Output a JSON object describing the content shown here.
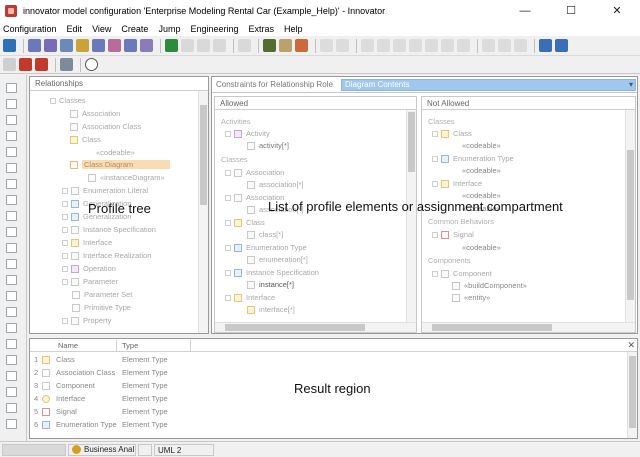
{
  "window": {
    "title": "innovator model configuration 'Enterprise Modeling Rental Car (Example_Help)' - Innovator",
    "minimize_glyph": "—",
    "maximize_glyph": "☐",
    "close_glyph": "✕"
  },
  "menu": [
    "Configuration",
    "Edit",
    "View",
    "Create",
    "Jump",
    "Engineering",
    "Extras",
    "Help"
  ],
  "left_pane": {
    "header": "Relationships",
    "root": "Classes",
    "items": [
      {
        "label": "Association",
        "icon": "association-icon"
      },
      {
        "label": "Association Class",
        "icon": "association-class-icon"
      },
      {
        "label": "Class",
        "icon": "class-icon"
      },
      {
        "label": "«codeable»",
        "icon": ""
      },
      {
        "label": "Class Diagram",
        "icon": "class-diagram-icon"
      },
      {
        "label": "«instanceDiagram»",
        "icon": "instance-diagram-icon"
      },
      {
        "label": "Enumeration Literal",
        "icon": "enumeration-literal-icon"
      },
      {
        "label": "Generalization",
        "icon": "generalization-icon"
      },
      {
        "label": "Generalization",
        "icon": "generalization-icon"
      },
      {
        "label": "Instance Specification",
        "icon": "instance-specification-icon"
      },
      {
        "label": "Interface",
        "icon": "interface-icon"
      },
      {
        "label": "Interface Realization",
        "icon": "interface-realization-icon"
      },
      {
        "label": "Operation",
        "icon": "operation-icon"
      },
      {
        "label": "Parameter",
        "icon": "parameter-icon"
      },
      {
        "label": "Parameter Set",
        "icon": "parameter-set-icon"
      },
      {
        "label": "Primitive Type",
        "icon": "primitive-type-icon"
      },
      {
        "label": "Property",
        "icon": "property-icon"
      }
    ],
    "overlay": "Profile tree"
  },
  "constraints": {
    "label": "Constraints for Relationship Role",
    "selected": "Diagram Contents",
    "overlay": "List of  profile elements or assignment compartment"
  },
  "allowed": {
    "header": "Allowed",
    "groups": [
      {
        "category": "Activities",
        "items": [
          "Activity",
          "activity[*]"
        ]
      },
      {
        "category": "Classes",
        "items": [
          "Association",
          "association[*]",
          "Association",
          "association[*]",
          "Class",
          "class[*]",
          "Enumeration Type",
          "enumeration[*]",
          "Instance Specification",
          "instance[*]",
          "Interface",
          "interface[*]"
        ]
      }
    ]
  },
  "not_allowed": {
    "header": "Not Allowed",
    "groups": [
      {
        "category": "Classes",
        "items": [
          "Class",
          "«codeable»",
          "Enumeration Type",
          "«codeable»",
          "Interface",
          "«codeable»",
          "«codeable»"
        ]
      },
      {
        "category": "Common Behaviors",
        "items": [
          "Signal",
          "«codeable»"
        ]
      },
      {
        "category": "Components",
        "items": [
          "Component",
          "«buildComponent»",
          "«entity»"
        ]
      }
    ]
  },
  "result": {
    "columns": [
      "Name",
      "Type"
    ],
    "rows": [
      {
        "num": "1",
        "name": "Class",
        "type": "Element Type"
      },
      {
        "num": "2",
        "name": "Association Class",
        "type": "Element Type"
      },
      {
        "num": "3",
        "name": "Component",
        "type": "Element Type"
      },
      {
        "num": "4",
        "name": "Interface",
        "type": "Element Type"
      },
      {
        "num": "5",
        "name": "Signal",
        "type": "Element Type"
      },
      {
        "num": "6",
        "name": "Enumeration Type",
        "type": "Element Type"
      }
    ],
    "overlay": "Result region",
    "close_glyph": "✕"
  },
  "status": {
    "profile": "Business Anal",
    "uml": "UML 2"
  },
  "colors": {
    "highlight": "#9fc7ef",
    "selection": "#f9dcb4"
  }
}
